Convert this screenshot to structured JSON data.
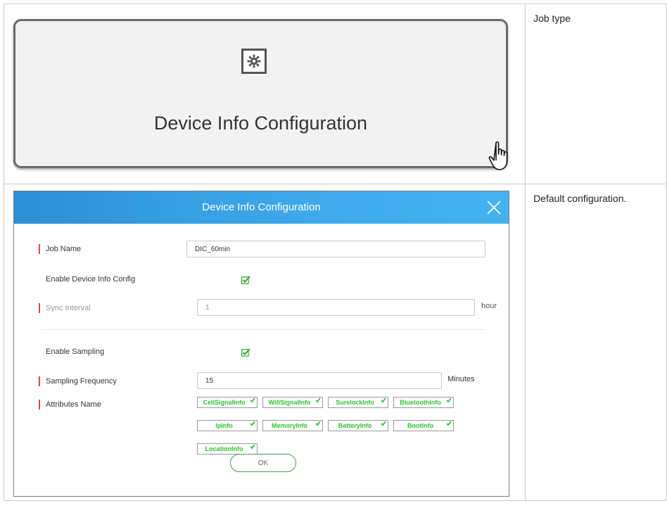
{
  "row1": {
    "tile_label": "Device Info Configuration",
    "description": "Job type"
  },
  "row2": {
    "description": "Default configuration."
  },
  "dialog": {
    "title": "Device Info Configuration",
    "job_name": {
      "label": "Job Name",
      "value": "DIC_60min"
    },
    "enable_device_info": {
      "label": "Enable Device Info Config",
      "checked": true
    },
    "sync_interval": {
      "label": "Sync Interval",
      "value": "1",
      "unit": "hour",
      "disabled": true
    },
    "enable_sampling": {
      "label": "Enable Sampling",
      "checked": true
    },
    "sampling_frequency": {
      "label": "Sampling Frequency",
      "value": "15",
      "unit": "Minutes"
    },
    "attributes": {
      "label": "Attributes Name",
      "items": [
        "CellSignalInfo",
        "WifiSignalInfo",
        "SurelockInfo",
        "BluetoothInfo",
        "IpInfo",
        "MemoryInfo",
        "BatteryInfo",
        "BootInfo",
        "LocationInfo"
      ]
    },
    "ok_label": "OK"
  },
  "colors": {
    "header_blue": "#3fa9ec",
    "required_red": "#e0473e",
    "check_green": "#2ec22e",
    "ok_border_green": "#4a9e4a"
  }
}
